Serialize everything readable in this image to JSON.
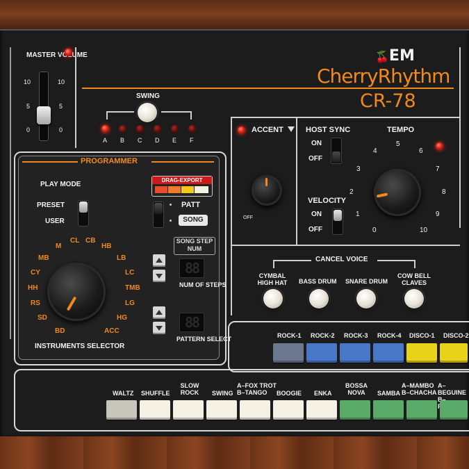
{
  "brand": {
    "logo_text": "EM",
    "name": "CherryRhythm",
    "model": "CR-78"
  },
  "master": {
    "label": "MASTER VOLUME",
    "scale_left": [
      "10",
      "5",
      "0"
    ],
    "scale_right": [
      "10",
      "5",
      "0"
    ]
  },
  "swing": {
    "label": "SWING",
    "leds": [
      "A",
      "B",
      "C",
      "D",
      "E",
      "F"
    ],
    "active": "A"
  },
  "programmer": {
    "title": "PROGRAMMER",
    "play_mode": "PLAY MODE",
    "preset": "PRESET",
    "user": "USER",
    "drag_export": "DRAG-EXPORT",
    "patt": "PATT",
    "song": "SONG",
    "song_step_num": "SONG STEP NUM",
    "num_of_steps": "NUM OF STEPS",
    "pattern_select": "PATTERN SELECT",
    "display_num_steps": "88",
    "display_pattern": "88",
    "instruments_selector": "INSTRUMENTS SELECTOR",
    "instruments": [
      "BD",
      "SD",
      "RS",
      "HH",
      "CY",
      "MB",
      "M",
      "CL",
      "CB",
      "HB",
      "LB",
      "LC",
      "TMB",
      "LG",
      "HG",
      "ACC"
    ],
    "instrument_value": "BD"
  },
  "accent": {
    "label": "ACCENT",
    "off_label": "OFF"
  },
  "host_sync": {
    "label": "HOST SYNC",
    "on": "ON",
    "off": "OFF",
    "state": "off"
  },
  "velocity": {
    "label": "VELOCITY",
    "on": "ON",
    "off": "OFF",
    "state": "off"
  },
  "tempo": {
    "label": "TEMPO",
    "scale": [
      "0",
      "1",
      "2",
      "3",
      "4",
      "5",
      "6",
      "7",
      "8",
      "9",
      "10"
    ],
    "value": 2
  },
  "cancel_voice": {
    "label": "CANCEL VOICE",
    "buttons": [
      "CYMBAL HIGH HAT",
      "BASS DRUM",
      "SNARE DRUM",
      "COW BELL CLAVES"
    ]
  },
  "rhythm_top": {
    "labels": [
      "ROCK-1",
      "ROCK-2",
      "ROCK-3",
      "ROCK-4",
      "DISCO-1",
      "DISCO-2"
    ],
    "colors": [
      "#6c7890",
      "#4a78c8",
      "#4a78c8",
      "#4a78c8",
      "#e8d21a",
      "#e8d21a"
    ]
  },
  "rhythm_bottom": {
    "labels": [
      "WALTZ",
      "SHUFFLE",
      "SLOW ROCK",
      "SWING",
      "A–FOX TROT B–TANGO",
      "BOOGIE",
      "ENKA",
      "BOSSA NOVA",
      "SAMBA",
      "A–MAMBO B–CHACHA",
      "A–BEGUINE B–RHUMBA"
    ],
    "colors": [
      "#c8c6bc",
      "#f4f1e4",
      "#f4f1e4",
      "#f4f1e4",
      "#f4f1e4",
      "#f4f1e4",
      "#f4f1e4",
      "#5aaa6a",
      "#5aaa6a",
      "#5aaa6a",
      "#5aaa6a"
    ]
  },
  "colors": {
    "accent_orange": "#f08a1c",
    "led_red": "#e0281a",
    "panel": "#1c1c1c"
  }
}
